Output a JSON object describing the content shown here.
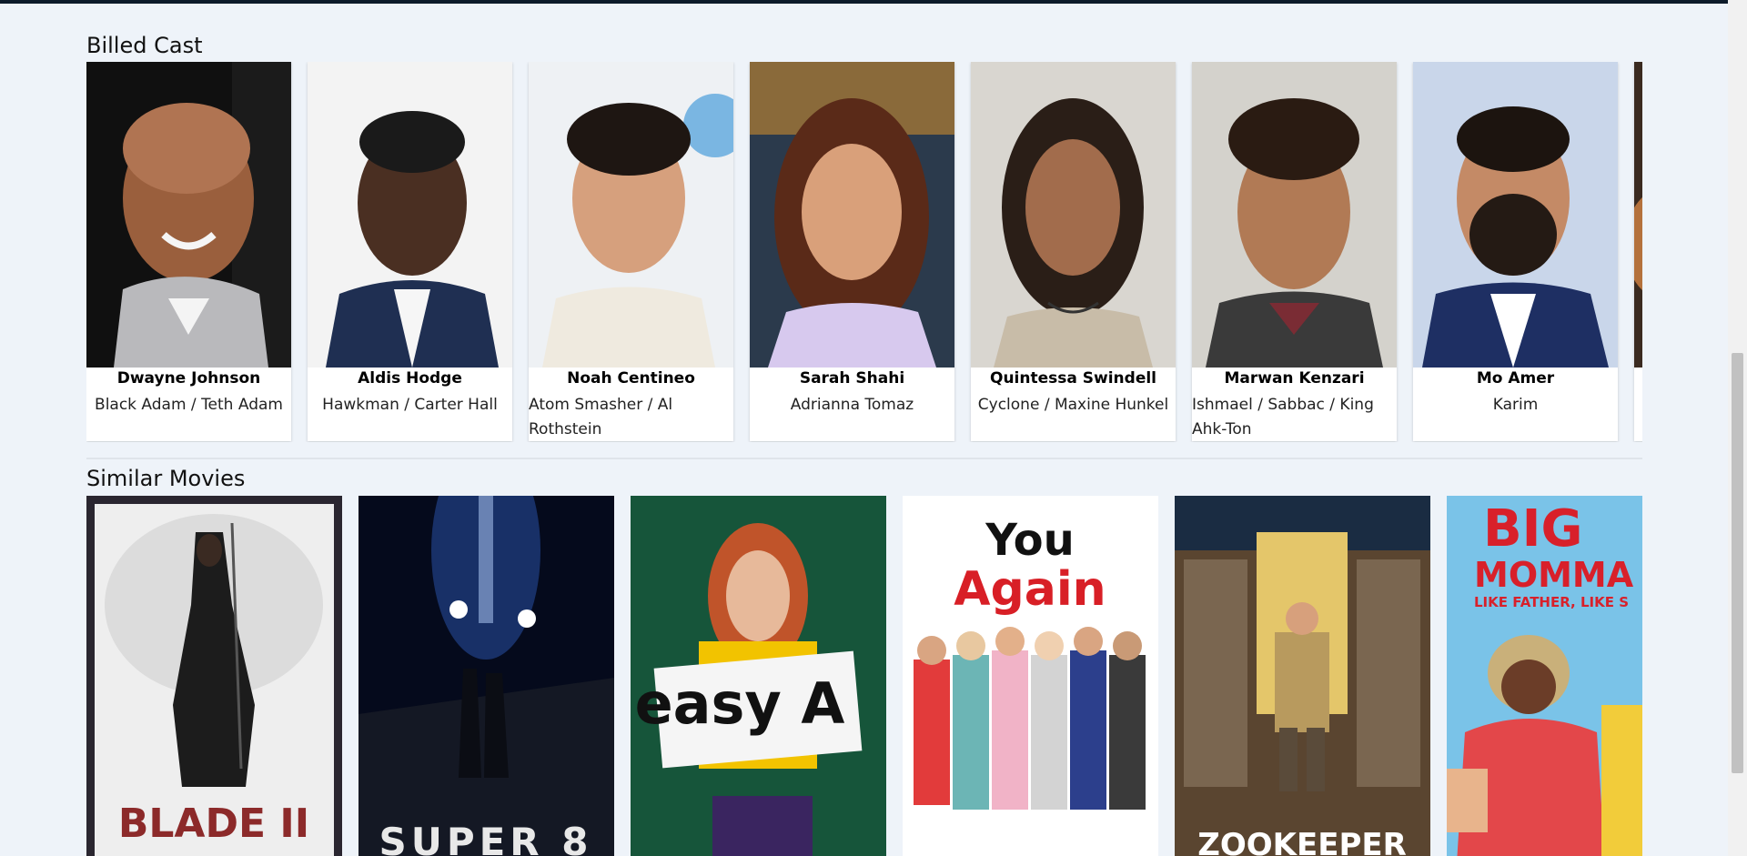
{
  "cast_section": {
    "title": "Billed Cast",
    "members": [
      {
        "name": "Dwayne Johnson",
        "role": "Black Adam / Teth Adam"
      },
      {
        "name": "Aldis Hodge",
        "role": "Hawkman / Carter Hall"
      },
      {
        "name": "Noah Centineo",
        "role": "Atom Smasher / Al Rothstein"
      },
      {
        "name": "Sarah Shahi",
        "role": "Adrianna Tomaz"
      },
      {
        "name": "Quintessa Swindell",
        "role": "Cyclone / Maxine Hunkel"
      },
      {
        "name": "Marwan Kenzari",
        "role": "Ishmael / Sabbac / King Ahk-Ton"
      },
      {
        "name": "Mo Amer",
        "role": "Karim"
      }
    ]
  },
  "similar_section": {
    "title": "Similar Movies",
    "movies": [
      {
        "poster_text": "BLADE II"
      },
      {
        "poster_text": "SUPER 8"
      },
      {
        "poster_text": "easy A"
      },
      {
        "poster_text_1": "You",
        "poster_text_2": "Again"
      },
      {
        "poster_text": "ZOOKEEPER"
      },
      {
        "poster_text_1": "BIG",
        "poster_text_2": "MOMMA",
        "poster_text_3": "LIKE FATHER, LIKE S"
      }
    ]
  },
  "colors": {
    "page_background": "#eef3f9",
    "card_background": "#ffffff",
    "top_bar": "#0d1b2a"
  }
}
